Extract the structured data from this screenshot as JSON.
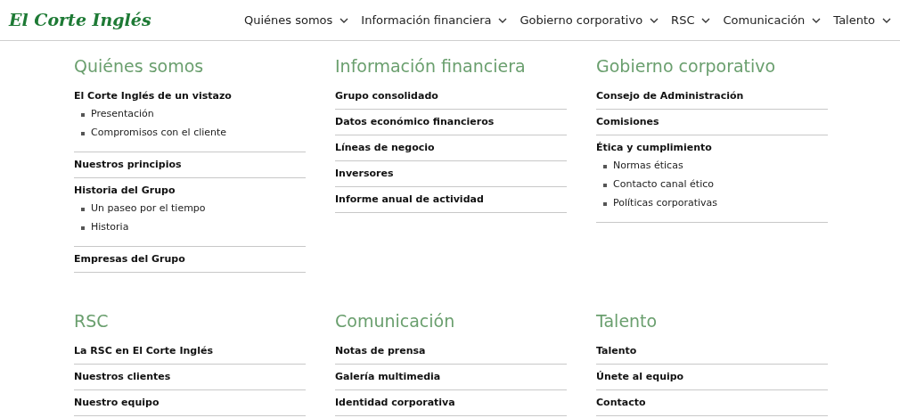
{
  "header": {
    "logo": "El Corte Inglés",
    "nav": [
      {
        "label": "Quiénes somos"
      },
      {
        "label": "Información financiera"
      },
      {
        "label": "Gobierno corporativo"
      },
      {
        "label": "RSC"
      },
      {
        "label": "Comunicación"
      },
      {
        "label": "Talento"
      }
    ]
  },
  "sections": [
    {
      "title": "Quiénes somos",
      "items": [
        {
          "label": "El Corte Inglés de un vistazo",
          "children": [
            "Presentación",
            "Compromisos con el cliente"
          ]
        },
        {
          "label": "Nuestros principios"
        },
        {
          "label": "Historia del Grupo",
          "children": [
            "Un paseo por el tiempo",
            "Historia"
          ]
        },
        {
          "label": "Empresas del Grupo"
        }
      ]
    },
    {
      "title": "Información financiera",
      "items": [
        {
          "label": "Grupo consolidado"
        },
        {
          "label": "Datos económico financieros"
        },
        {
          "label": "Líneas de negocio"
        },
        {
          "label": "Inversores"
        },
        {
          "label": "Informe anual de actividad"
        }
      ]
    },
    {
      "title": "Gobierno corporativo",
      "items": [
        {
          "label": "Consejo de Administración"
        },
        {
          "label": "Comisiones"
        },
        {
          "label": "Ética y cumplimiento",
          "children": [
            "Normas éticas",
            "Contacto canal ético",
            "Políticas corporativas"
          ]
        }
      ]
    },
    {
      "title": "RSC",
      "items": [
        {
          "label": "La RSC en El Corte Inglés"
        },
        {
          "label": "Nuestros clientes"
        },
        {
          "label": "Nuestro equipo"
        }
      ]
    },
    {
      "title": "Comunicación",
      "items": [
        {
          "label": "Notas de prensa"
        },
        {
          "label": "Galería multimedia"
        },
        {
          "label": "Identidad corporativa"
        }
      ]
    },
    {
      "title": "Talento",
      "items": [
        {
          "label": "Talento"
        },
        {
          "label": "Únete al equipo"
        },
        {
          "label": "Contacto"
        }
      ]
    }
  ]
}
